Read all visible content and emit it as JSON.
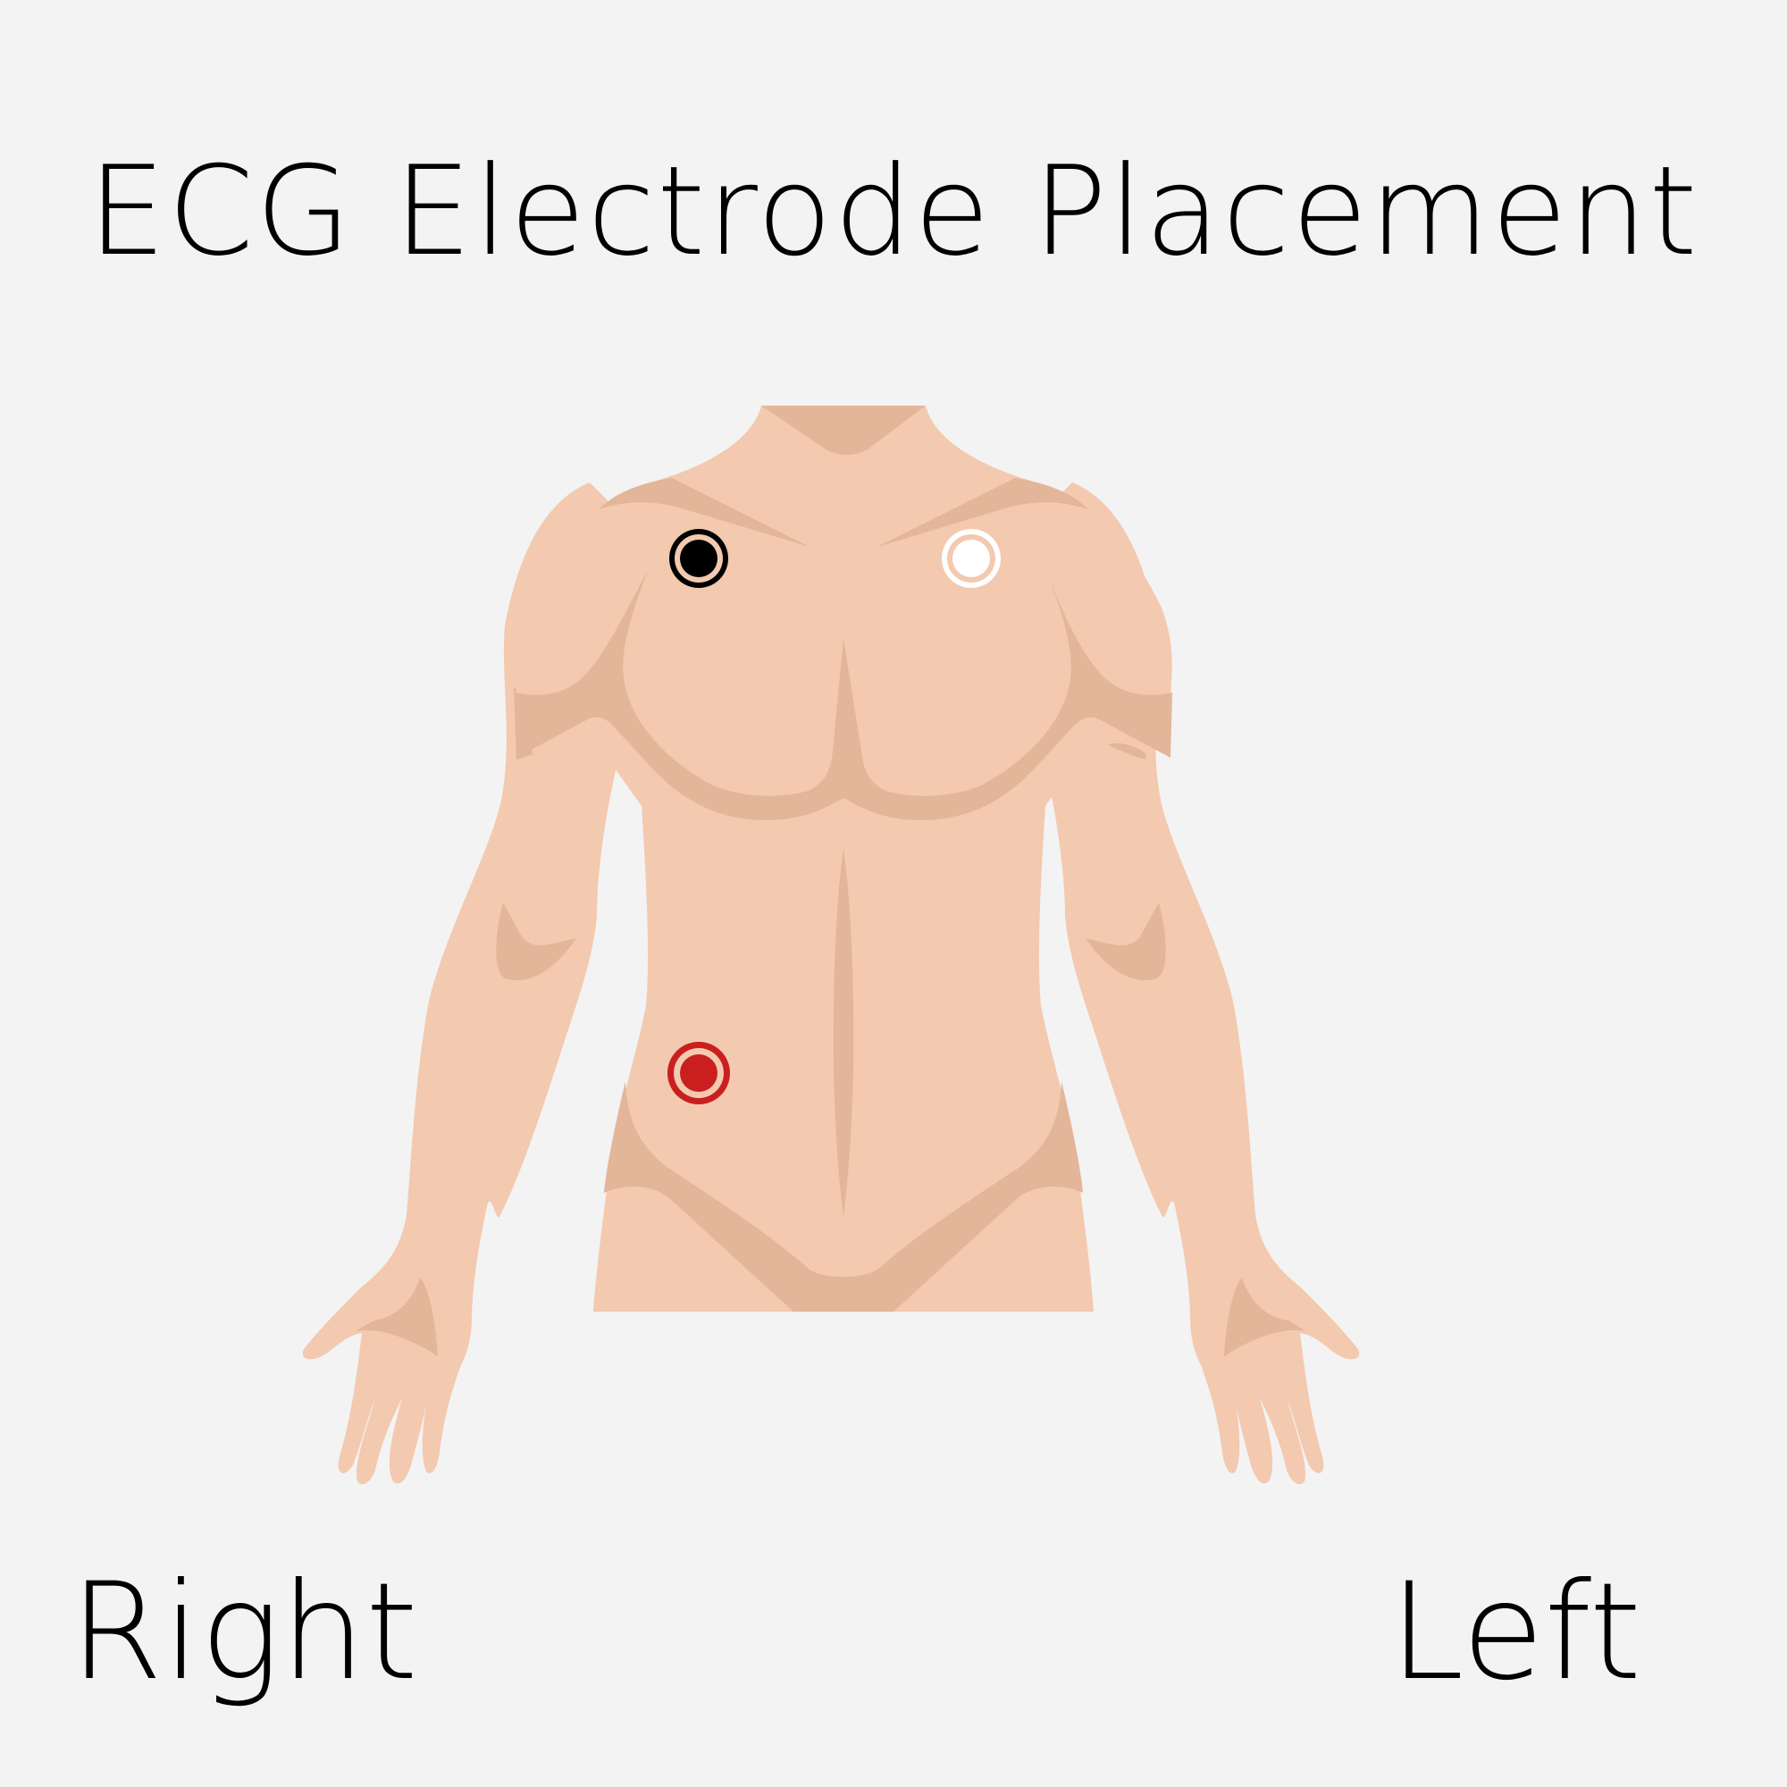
{
  "title": "ECG Electrode Placement",
  "labels": {
    "right": "Right",
    "left": "Left"
  },
  "colors": {
    "background": "#f3f3f3",
    "skin": "#f3c9b0",
    "skin_shade": "#e3b699",
    "electrode_ra": "#000000",
    "electrode_la": "#ffffff",
    "electrode_ll": "#c91f1f"
  },
  "electrodes": [
    {
      "id": "right-arm",
      "color": "#000000"
    },
    {
      "id": "left-arm",
      "color": "#ffffff"
    },
    {
      "id": "left-leg",
      "color": "#c91f1f"
    }
  ]
}
